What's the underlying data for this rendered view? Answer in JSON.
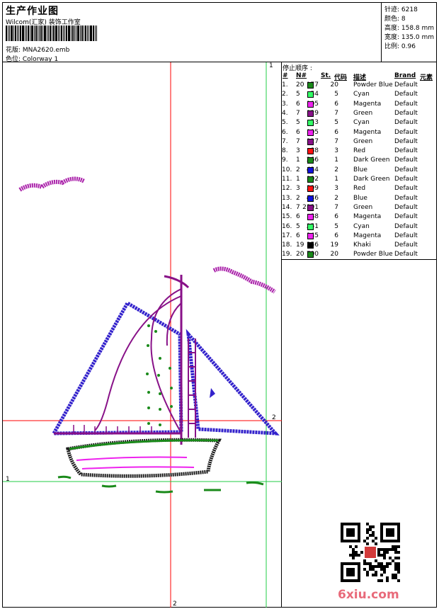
{
  "header": {
    "title": "生产作业图",
    "company": "Wilcom(汇家) 装饰工作室",
    "pattern": "花版:  MNA2620.emb",
    "colorway": "色位:  Colorway 1"
  },
  "stats": [
    "针迹:  6218",
    "颜色:  8",
    "高度:  158.8 mm",
    "宽度:  135.0 mm",
    "比例:  0.96"
  ],
  "stop_sequence": {
    "title": "停止顺序 :",
    "headers": [
      "#",
      "N#",
      "St.",
      "代码",
      "描述",
      "Brand",
      "元素"
    ],
    "rows": [
      {
        "idx": "1.",
        "n": "20",
        "color": "#1a8a1a",
        "st": "177",
        "code": "20",
        "desc": "Powder Blue",
        "brand": "Default"
      },
      {
        "idx": "2.",
        "n": "5",
        "color": "#33ff66",
        "st": "54",
        "code": "5",
        "desc": "Cyan",
        "brand": "Default"
      },
      {
        "idx": "3.",
        "n": "6",
        "color": "#ee22ee",
        "st": "105",
        "code": "6",
        "desc": "Magenta",
        "brand": "Default"
      },
      {
        "idx": "4.",
        "n": "7",
        "color": "#881188",
        "st": "129",
        "code": "7",
        "desc": "Green",
        "brand": "Default"
      },
      {
        "idx": "5.",
        "n": "5",
        "color": "#33ff66",
        "st": "53",
        "code": "5",
        "desc": "Cyan",
        "brand": "Default"
      },
      {
        "idx": "6.",
        "n": "6",
        "color": "#ee22ee",
        "st": "105",
        "code": "6",
        "desc": "Magenta",
        "brand": "Default"
      },
      {
        "idx": "7.",
        "n": "7",
        "color": "#881188",
        "st": "127",
        "code": "7",
        "desc": "Green",
        "brand": "Default"
      },
      {
        "idx": "8.",
        "n": "3",
        "color": "#ff1111",
        "st": "88",
        "code": "3",
        "desc": "Red",
        "brand": "Default"
      },
      {
        "idx": "9.",
        "n": "1",
        "color": "#1a8a1a",
        "st": "266",
        "code": "1",
        "desc": "Dark Green",
        "brand": "Default"
      },
      {
        "idx": "10.",
        "n": "2",
        "color": "#1111dd",
        "st": "434",
        "code": "2",
        "desc": "Blue",
        "brand": "Default"
      },
      {
        "idx": "11.",
        "n": "1",
        "color": "#1a8a1a",
        "st": "102",
        "code": "1",
        "desc": "Dark Green",
        "brand": "Default"
      },
      {
        "idx": "12.",
        "n": "3",
        "color": "#ff1111",
        "st": "399",
        "code": "3",
        "desc": "Red",
        "brand": "Default"
      },
      {
        "idx": "13.",
        "n": "2",
        "color": "#1111dd",
        "st": "446",
        "code": "2",
        "desc": "Blue",
        "brand": "Default"
      },
      {
        "idx": "14.",
        "n": "7",
        "color": "#881188",
        "st": "2191",
        "code": "7",
        "desc": "Green",
        "brand": "Default"
      },
      {
        "idx": "15.",
        "n": "6",
        "color": "#ee22ee",
        "st": "88",
        "code": "6",
        "desc": "Magenta",
        "brand": "Default"
      },
      {
        "idx": "16.",
        "n": "5",
        "color": "#33ff66",
        "st": "251",
        "code": "5",
        "desc": "Cyan",
        "brand": "Default"
      },
      {
        "idx": "17.",
        "n": "6",
        "color": "#ee22ee",
        "st": "145",
        "code": "6",
        "desc": "Magenta",
        "brand": "Default"
      },
      {
        "idx": "18.",
        "n": "19",
        "color": "#000000",
        "st": "356",
        "code": "19",
        "desc": "Khaki",
        "brand": "Default"
      },
      {
        "idx": "19.",
        "n": "20",
        "color": "#1a8a1a",
        "st": "700",
        "code": "20",
        "desc": "Powder Blue",
        "brand": "Default"
      }
    ]
  },
  "axis_labels": {
    "v_green": "1",
    "h_red": "2",
    "h_green": "1",
    "v_red": "2"
  },
  "watermark": "6xiu.com",
  "colors": {
    "red_axis": "#ff0000",
    "green_axis": "#22cc44",
    "sail_outline": "#3322cc",
    "hull": "#1a1a1a",
    "mast": "#881188",
    "cloud": "#aa22aa"
  }
}
